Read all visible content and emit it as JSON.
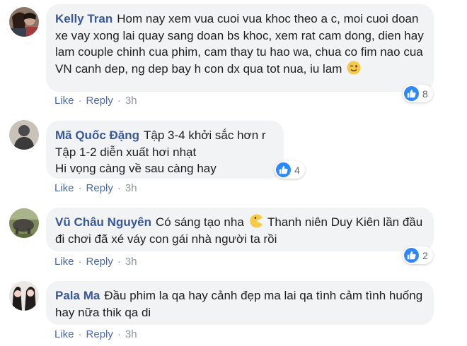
{
  "actions": {
    "like_label": "Like",
    "reply_label": "Reply",
    "separator": "·"
  },
  "comments": [
    {
      "author": "Kelly Tran",
      "text": "Hom nay xem vua cuoi vua khoc theo a c, moi cuoi doan xe vay xong lai quay sang doan bs khoc, xem rat cam dong, dien hay lam couple chinh cua phim, cam thay tu hao wa, chua co fim nao cua VN canh dep, ng dep bay h con dx qua tot nua, iu lam",
      "emoji": "winking-face-emoji",
      "reaction_count": "8",
      "time": "3h"
    },
    {
      "author": "Mã Quốc Đặng",
      "line1": "Tập 3-4 khởi sắc hơn r",
      "line2": "Tập 1-2 diễn xuất hơi nhạt",
      "line3": "Hi vọng càng về sau càng hay",
      "reaction_count": "4",
      "time": "3h"
    },
    {
      "author": "Vũ Châu Nguyên",
      "text_before": "Có sáng tạo nha",
      "emoji": "pacman-emoji",
      "text_after": "Thanh niên Duy Kiên lần đầu đi chơi đã xé váy con gái nhà người ta rồi",
      "reaction_count": "2",
      "time": "3h"
    },
    {
      "author": "Pala Ma",
      "text": "Đầu phim la qa hay cảnh đẹp ma lai qa tình cảm tình huống hay nữa thik qa di",
      "time": "3h"
    }
  ]
}
